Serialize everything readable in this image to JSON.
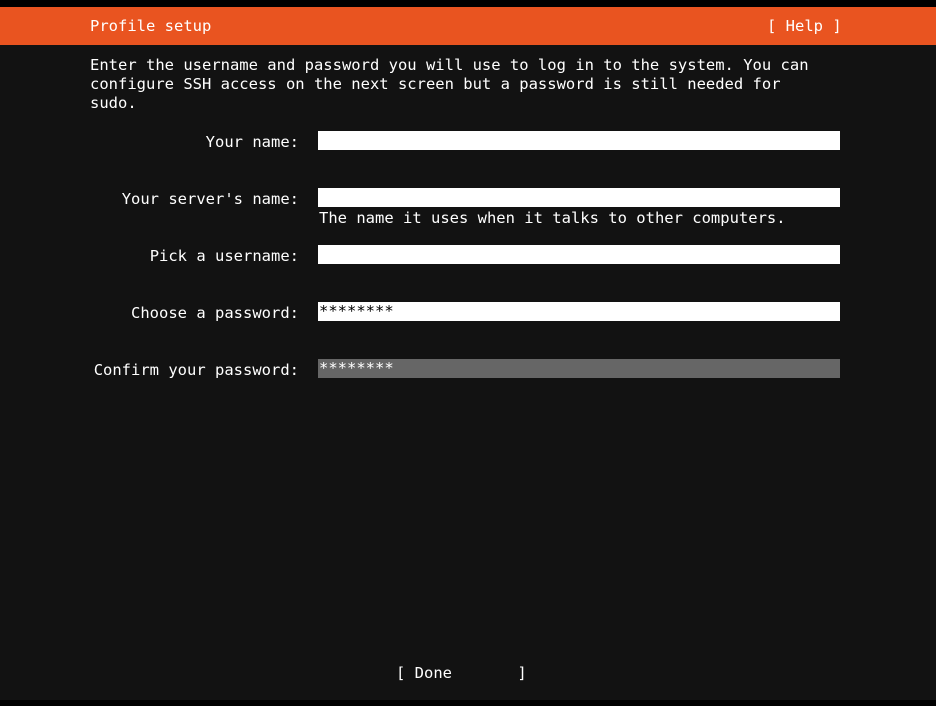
{
  "header": {
    "title": "Profile setup",
    "help_label": "[ Help ]"
  },
  "intro": {
    "lines": [
      "Enter the username and password you will use to log in to the system. You can",
      "configure SSH access on the next screen but a password is still needed for",
      "sudo."
    ]
  },
  "form": {
    "your_name": {
      "label": "Your name:",
      "value_masked": true
    },
    "server_name": {
      "label": "Your server's name:",
      "value_masked": true,
      "hint": "The name it uses when it talks to other computers."
    },
    "username": {
      "label": "Pick a username:",
      "value_masked": true
    },
    "password": {
      "label": "Choose a password:",
      "value": "********"
    },
    "confirm_password": {
      "label": "Confirm your password:",
      "value": "********"
    }
  },
  "footer": {
    "done_label": "[ Done       ]"
  },
  "colors": {
    "accent": "#e95420",
    "background": "#121212",
    "field": "#ffffff",
    "focused_field": "#666666"
  }
}
